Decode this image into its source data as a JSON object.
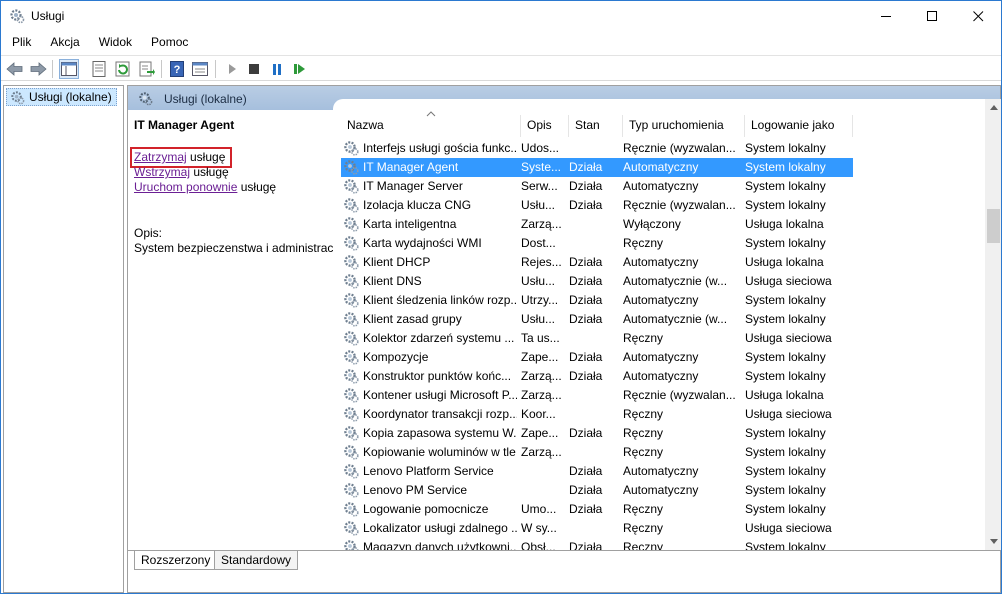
{
  "window": {
    "title": "Usługi",
    "minimize_icon": "minimize-icon",
    "maximize_icon": "maximize-icon",
    "close_icon": "close-icon"
  },
  "menu": [
    "Plik",
    "Akcja",
    "Widok",
    "Pomoc"
  ],
  "toolbar": {
    "icons": [
      "back-arrow-icon",
      "forward-arrow-icon",
      "console-tree-icon",
      "properties-icon",
      "refresh-icon",
      "export-list-icon",
      "help-icon",
      "view-icon",
      "start-service-icon",
      "stop-service-icon",
      "pause-service-icon",
      "restart-service-icon"
    ]
  },
  "tree": {
    "selected_item": "Usługi (lokalne)"
  },
  "main": {
    "header_title": "Usługi (lokalne)",
    "extended": {
      "service_name": "IT Manager Agent",
      "stop_link": "Zatrzymaj",
      "stop_suffix": " usługę",
      "pause_link": "Wstrzymaj",
      "pause_suffix": " usługę",
      "restart_link": "Uruchom ponownie",
      "restart_suffix": " usługę",
      "description_label": "Opis:",
      "description": "System bezpieczenstwa i administracji"
    },
    "columns": [
      "Nazwa",
      "Opis",
      "Stan",
      "Typ uruchomienia",
      "Logowanie jako"
    ],
    "rows": [
      {
        "name": "Interfejs usługi gościa funkc...",
        "desc": "Udos...",
        "state": "",
        "startup": "Ręcznie (wyzwalan...",
        "logon": "System lokalny",
        "selected": false
      },
      {
        "name": "IT Manager Agent",
        "desc": "Syste...",
        "state": "Działa",
        "startup": "Automatyczny",
        "logon": "System lokalny",
        "selected": true
      },
      {
        "name": "IT Manager Server",
        "desc": "Serw...",
        "state": "Działa",
        "startup": "Automatyczny",
        "logon": "System lokalny",
        "selected": false
      },
      {
        "name": "Izolacja klucza CNG",
        "desc": "Usłu...",
        "state": "Działa",
        "startup": "Ręcznie (wyzwalan...",
        "logon": "System lokalny",
        "selected": false
      },
      {
        "name": "Karta inteligentna",
        "desc": "Zarzą...",
        "state": "",
        "startup": "Wyłączony",
        "logon": "Usługa lokalna",
        "selected": false
      },
      {
        "name": "Karta wydajności WMI",
        "desc": "Dost...",
        "state": "",
        "startup": "Ręczny",
        "logon": "System lokalny",
        "selected": false
      },
      {
        "name": "Klient DHCP",
        "desc": "Rejes...",
        "state": "Działa",
        "startup": "Automatyczny",
        "logon": "Usługa lokalna",
        "selected": false
      },
      {
        "name": "Klient DNS",
        "desc": "Usłu...",
        "state": "Działa",
        "startup": "Automatycznie (w...",
        "logon": "Usługa sieciowa",
        "selected": false
      },
      {
        "name": "Klient śledzenia linków rozp...",
        "desc": "Utrzy...",
        "state": "Działa",
        "startup": "Automatyczny",
        "logon": "System lokalny",
        "selected": false
      },
      {
        "name": "Klient zasad grupy",
        "desc": "Usłu...",
        "state": "Działa",
        "startup": "Automatycznie (w...",
        "logon": "System lokalny",
        "selected": false
      },
      {
        "name": "Kolektor zdarzeń systemu ...",
        "desc": "Ta us...",
        "state": "",
        "startup": "Ręczny",
        "logon": "Usługa sieciowa",
        "selected": false
      },
      {
        "name": "Kompozycje",
        "desc": "Zape...",
        "state": "Działa",
        "startup": "Automatyczny",
        "logon": "System lokalny",
        "selected": false
      },
      {
        "name": "Konstruktor punktów końc...",
        "desc": "Zarzą...",
        "state": "Działa",
        "startup": "Automatyczny",
        "logon": "System lokalny",
        "selected": false
      },
      {
        "name": "Kontener usługi Microsoft P...",
        "desc": "Zarzą...",
        "state": "",
        "startup": "Ręcznie (wyzwalan...",
        "logon": "Usługa lokalna",
        "selected": false
      },
      {
        "name": "Koordynator transakcji rozp...",
        "desc": "Koor...",
        "state": "",
        "startup": "Ręczny",
        "logon": "Usługa sieciowa",
        "selected": false
      },
      {
        "name": "Kopia zapasowa systemu W...",
        "desc": "Zape...",
        "state": "Działa",
        "startup": "Ręczny",
        "logon": "System lokalny",
        "selected": false
      },
      {
        "name": "Kopiowanie woluminów w tle",
        "desc": "Zarzą...",
        "state": "",
        "startup": "Ręczny",
        "logon": "System lokalny",
        "selected": false
      },
      {
        "name": "Lenovo Platform Service",
        "desc": "",
        "state": "Działa",
        "startup": "Automatyczny",
        "logon": "System lokalny",
        "selected": false
      },
      {
        "name": "Lenovo PM Service",
        "desc": "",
        "state": "Działa",
        "startup": "Automatyczny",
        "logon": "System lokalny",
        "selected": false
      },
      {
        "name": "Logowanie pomocnicze",
        "desc": "Umo...",
        "state": "Działa",
        "startup": "Ręczny",
        "logon": "System lokalny",
        "selected": false
      },
      {
        "name": "Lokalizator usługi zdalnego ...",
        "desc": "W sy...",
        "state": "",
        "startup": "Ręczny",
        "logon": "Usługa sieciowa",
        "selected": false
      },
      {
        "name": "Magazyn danych użytkowni...",
        "desc": "Obsł...",
        "state": "Działa",
        "startup": "Ręczny",
        "logon": "System lokalny",
        "selected": false
      }
    ],
    "tabs": [
      "Rozszerzony",
      "Standardowy"
    ]
  },
  "colors": {
    "selection": "#3399ff",
    "header_gradient": "#b9cde4",
    "link": "#6b1f94",
    "highlight_box": "#d2232a"
  }
}
